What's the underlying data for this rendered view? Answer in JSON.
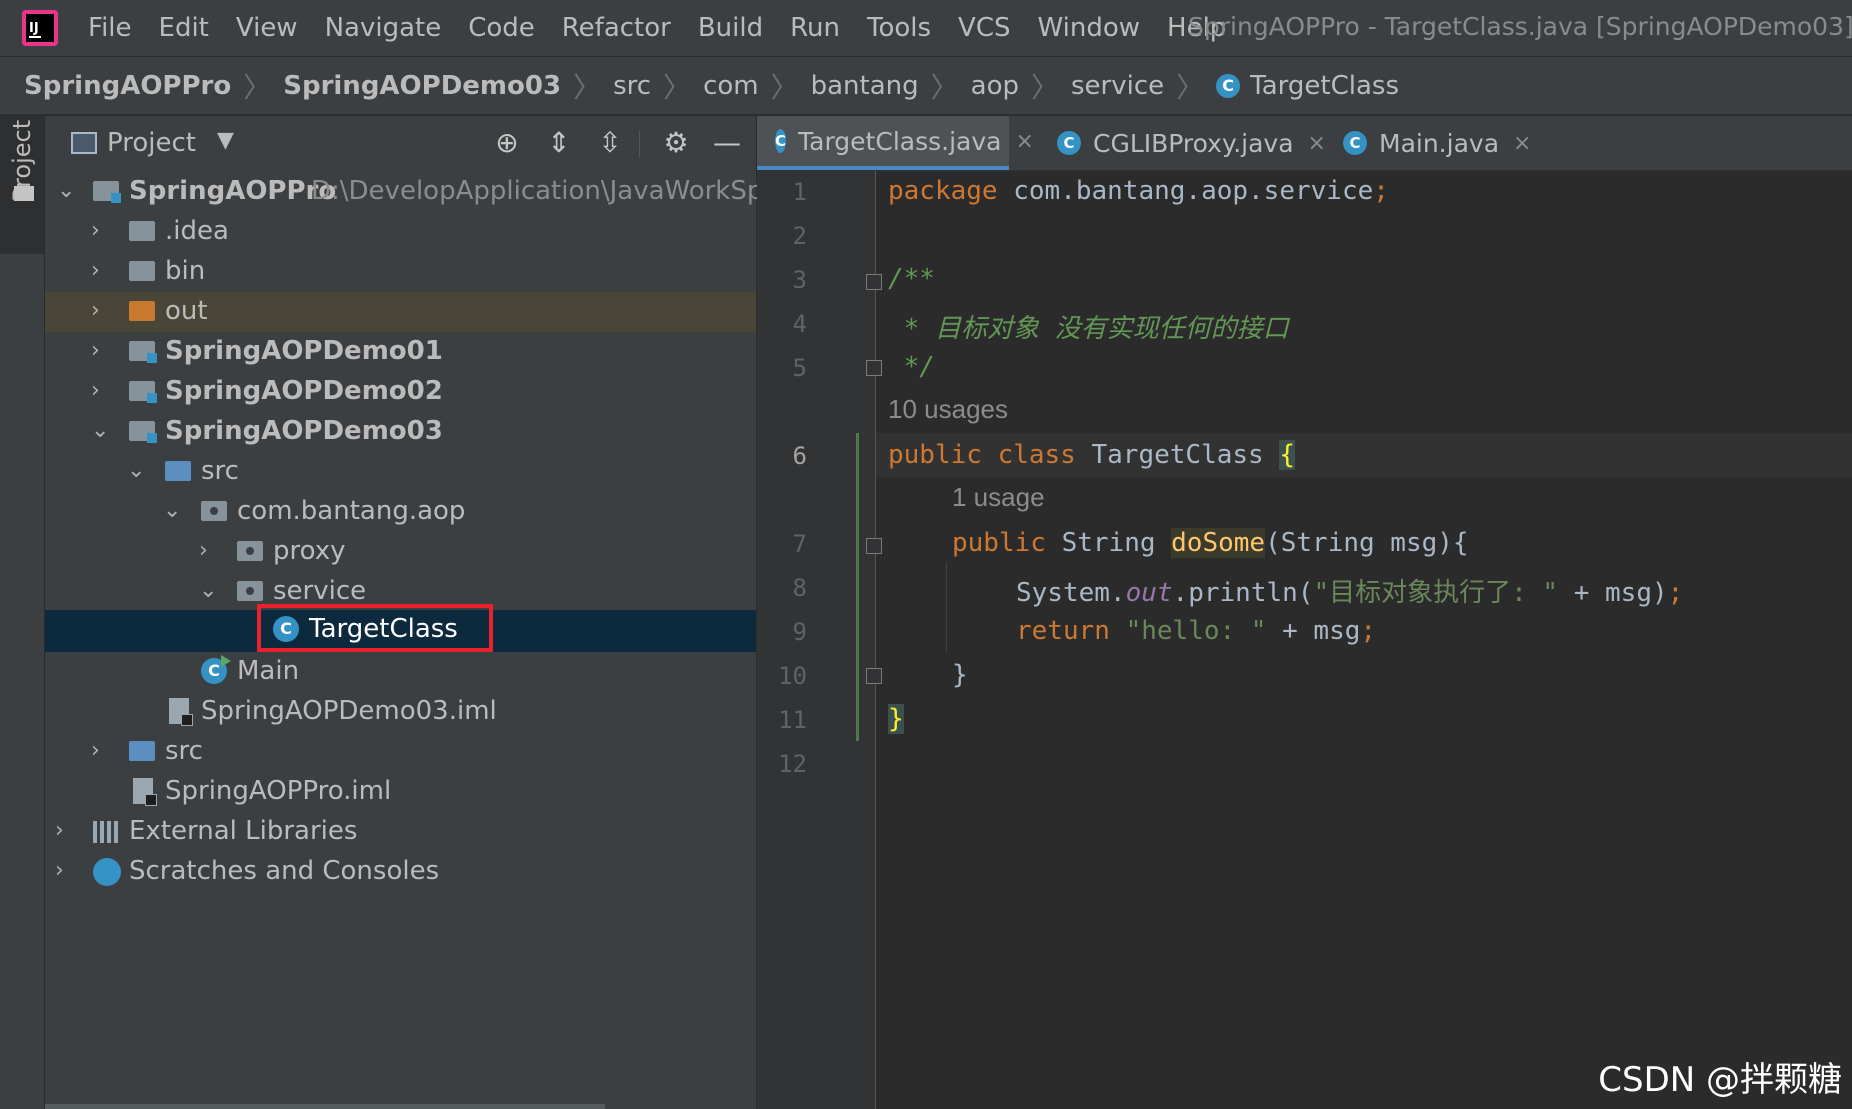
{
  "menubar": {
    "items": [
      "File",
      "Edit",
      "View",
      "Navigate",
      "Code",
      "Refactor",
      "Build",
      "Run",
      "Tools",
      "VCS",
      "Window",
      "Help"
    ],
    "window_title": "SpringAOPPro - TargetClass.java [SpringAOPDemo03]"
  },
  "breadcrumb": [
    "SpringAOPPro",
    "SpringAOPDemo03",
    "src",
    "com",
    "bantang",
    "aop",
    "service",
    "TargetClass"
  ],
  "stripe": {
    "label": "Project"
  },
  "project": {
    "title": "Project",
    "tree": [
      {
        "label": "SpringAOPPro",
        "path": "D:\\DevelopApplication\\JavaWorkSpace"
      },
      {
        "label": ".idea"
      },
      {
        "label": "bin"
      },
      {
        "label": "out"
      },
      {
        "label": "SpringAOPDemo01"
      },
      {
        "label": "SpringAOPDemo02"
      },
      {
        "label": "SpringAOPDemo03"
      },
      {
        "label": "src"
      },
      {
        "label": "com.bantang.aop"
      },
      {
        "label": "proxy"
      },
      {
        "label": "service"
      },
      {
        "label": "TargetClass"
      },
      {
        "label": "Main"
      },
      {
        "label": "SpringAOPDemo03.iml"
      },
      {
        "label": "src"
      },
      {
        "label": "SpringAOPPro.iml"
      },
      {
        "label": "External Libraries"
      },
      {
        "label": "Scratches and Consoles"
      }
    ]
  },
  "tabs": [
    {
      "label": "TargetClass.java",
      "icon": "class-icon"
    },
    {
      "label": "CGLIBProxy.java",
      "icon": "class-icon"
    },
    {
      "label": "Main.java",
      "icon": "main-class-icon"
    }
  ],
  "editor": {
    "line_numbers": [
      "1",
      "2",
      "3",
      "4",
      "5",
      "6",
      "7",
      "8",
      "9",
      "10",
      "11",
      "12"
    ],
    "line1": {
      "kw": "package",
      "rest": " com.bantang.aop.service",
      "semi": ";"
    },
    "line3": "/**",
    "line4": " * 目标对象 没有实现任何的接口",
    "line5": " */",
    "hint1": "10 usages",
    "line6": {
      "kw": "public class",
      "name": " TargetClass ",
      "brace": "{"
    },
    "hint2": "1 usage",
    "line7": {
      "kw": "public",
      "type": " String ",
      "method": "doSome",
      "rest": "(String msg){"
    },
    "line8": {
      "pre": "System.",
      "field": "out",
      "mid": ".println(",
      "str": "\"目标对象执行了: \"",
      "post": " + msg)",
      "semi": ";"
    },
    "line9": {
      "kw": "return",
      "str": " \"hello: \"",
      "post": " + msg",
      "semi": ";"
    },
    "line10": "}",
    "line11": "}"
  },
  "watermark": "CSDN @拌颗糖",
  "colors": {
    "accent": "#3592c4",
    "keyword": "#cc7832",
    "comment": "#629755",
    "string": "#6a8759",
    "highlight_box": "#e8212b"
  }
}
